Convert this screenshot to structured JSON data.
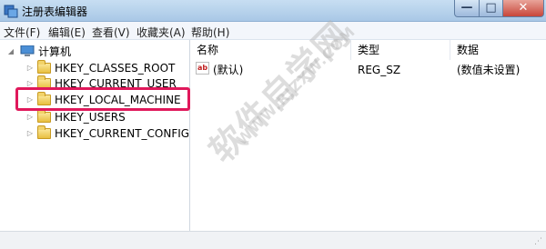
{
  "window": {
    "title": "注册表编辑器",
    "buttons": {
      "minimize": "—",
      "maximize": "□",
      "close": "✕"
    }
  },
  "menu": {
    "items": [
      "文件(F)",
      "编辑(E)",
      "查看(V)",
      "收藏夹(A)",
      "帮助(H)"
    ]
  },
  "tree": {
    "root": "计算机",
    "keys": [
      "HKEY_CLASSES_ROOT",
      "HKEY_CURRENT_USER",
      "HKEY_LOCAL_MACHINE",
      "HKEY_USERS",
      "HKEY_CURRENT_CONFIG"
    ],
    "highlighted_key": "HKEY_LOCAL_MACHINE"
  },
  "list": {
    "columns": [
      "名称",
      "类型",
      "数据"
    ],
    "rows": [
      {
        "name": "(默认)",
        "type": "REG_SZ",
        "data": "(数值未设置)"
      }
    ]
  },
  "watermark": {
    "text": "软件自学网",
    "url": "WWW.RJZXW.COM"
  },
  "colors": {
    "highlight_border": "#e0185b",
    "titlebar": "#b6d2ec"
  }
}
